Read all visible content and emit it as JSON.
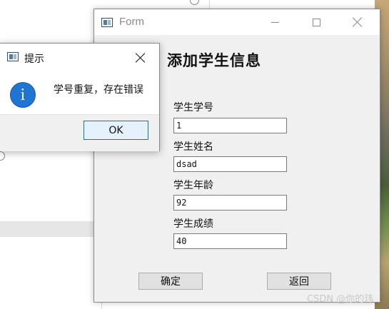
{
  "form": {
    "window_title": "Form",
    "heading": "添加学生信息",
    "fields": [
      {
        "label": "学生学号",
        "value": "1"
      },
      {
        "label": "学生姓名",
        "value": "dsad"
      },
      {
        "label": "学生年龄",
        "value": "92"
      },
      {
        "label": "学生成绩",
        "value": "40"
      }
    ],
    "confirm_label": "确定",
    "back_label": "返回",
    "icons": {
      "app": "app-window-icon",
      "minimize": "minimize-icon",
      "maximize": "maximize-icon",
      "close": "close-icon"
    }
  },
  "message_box": {
    "title": "提示",
    "message": "学号重复，存在错误",
    "ok_label": "OK",
    "icons": {
      "app": "app-window-icon",
      "info": "info-icon",
      "close": "close-icon"
    },
    "colors": {
      "info": "#1f75d1",
      "ok_border": "#0078d7"
    }
  },
  "watermark": "CSDN @你的玮"
}
